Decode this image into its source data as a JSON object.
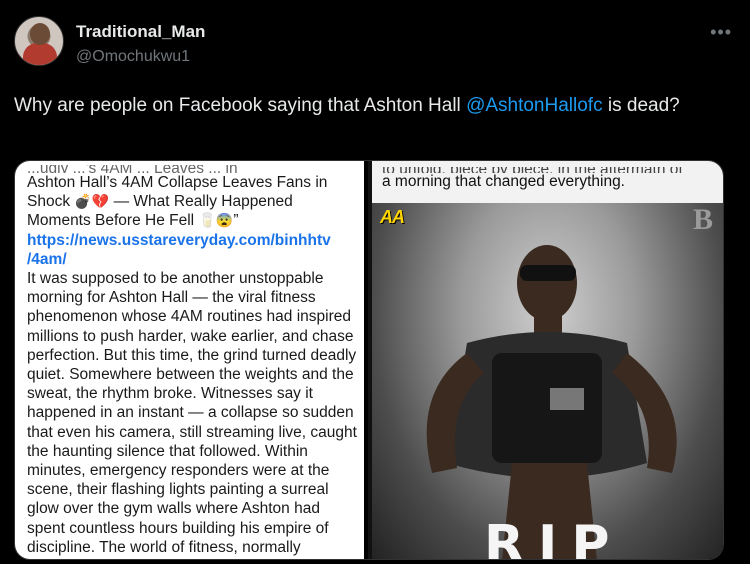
{
  "tweet": {
    "display_name": "Traditional_Man",
    "handle": "@Omochukwu1",
    "more_icon": "more-horizontal-icon",
    "text_before": "Why are people on Facebook saying that Ashton Hall ",
    "mention": "@AshtonHallofc",
    "text_after": " is dead?"
  },
  "left_image": {
    "cut_top": "...ugly ...'s 4AM ... Leaves ... in",
    "headline_1": "Ashton Hall’s 4AM Collapse Leaves Fans in",
    "headline_2": "Shock",
    "headline_3": " — What Really Happened",
    "headline_4": "Moments Before He Fell",
    "headline_5": "”",
    "emoji_a": "💣💔",
    "emoji_b": "🥛😨",
    "link_1": "https://news.usstareveryday.com/binhhtv",
    "link_2": "/4am/",
    "body": "It was supposed to be another unstoppable morning for Ashton Hall — the viral fitness phenomenon whose 4AM routines had inspired millions to push harder, wake earlier, and chase perfection. But this time, the grind turned deadly quiet. Somewhere between the weights and the sweat, the rhythm broke. Witnesses say it happened in an instant — a collapse so sudden that even his camera, still streaming live, caught the haunting silence that followed. Within minutes, emergency responders were at the scene, their flashing lights painting a surreal glow over the gym walls where Ashton had spent countless hours building his empire of discipline. The world of fitness, normally"
  },
  "right_image": {
    "cut_top": "to unfold, piece by piece, in the aftermath of",
    "caption": "a morning that changed everything.",
    "logo_left": "AA",
    "logo_right": "B",
    "rip": "RIP"
  }
}
